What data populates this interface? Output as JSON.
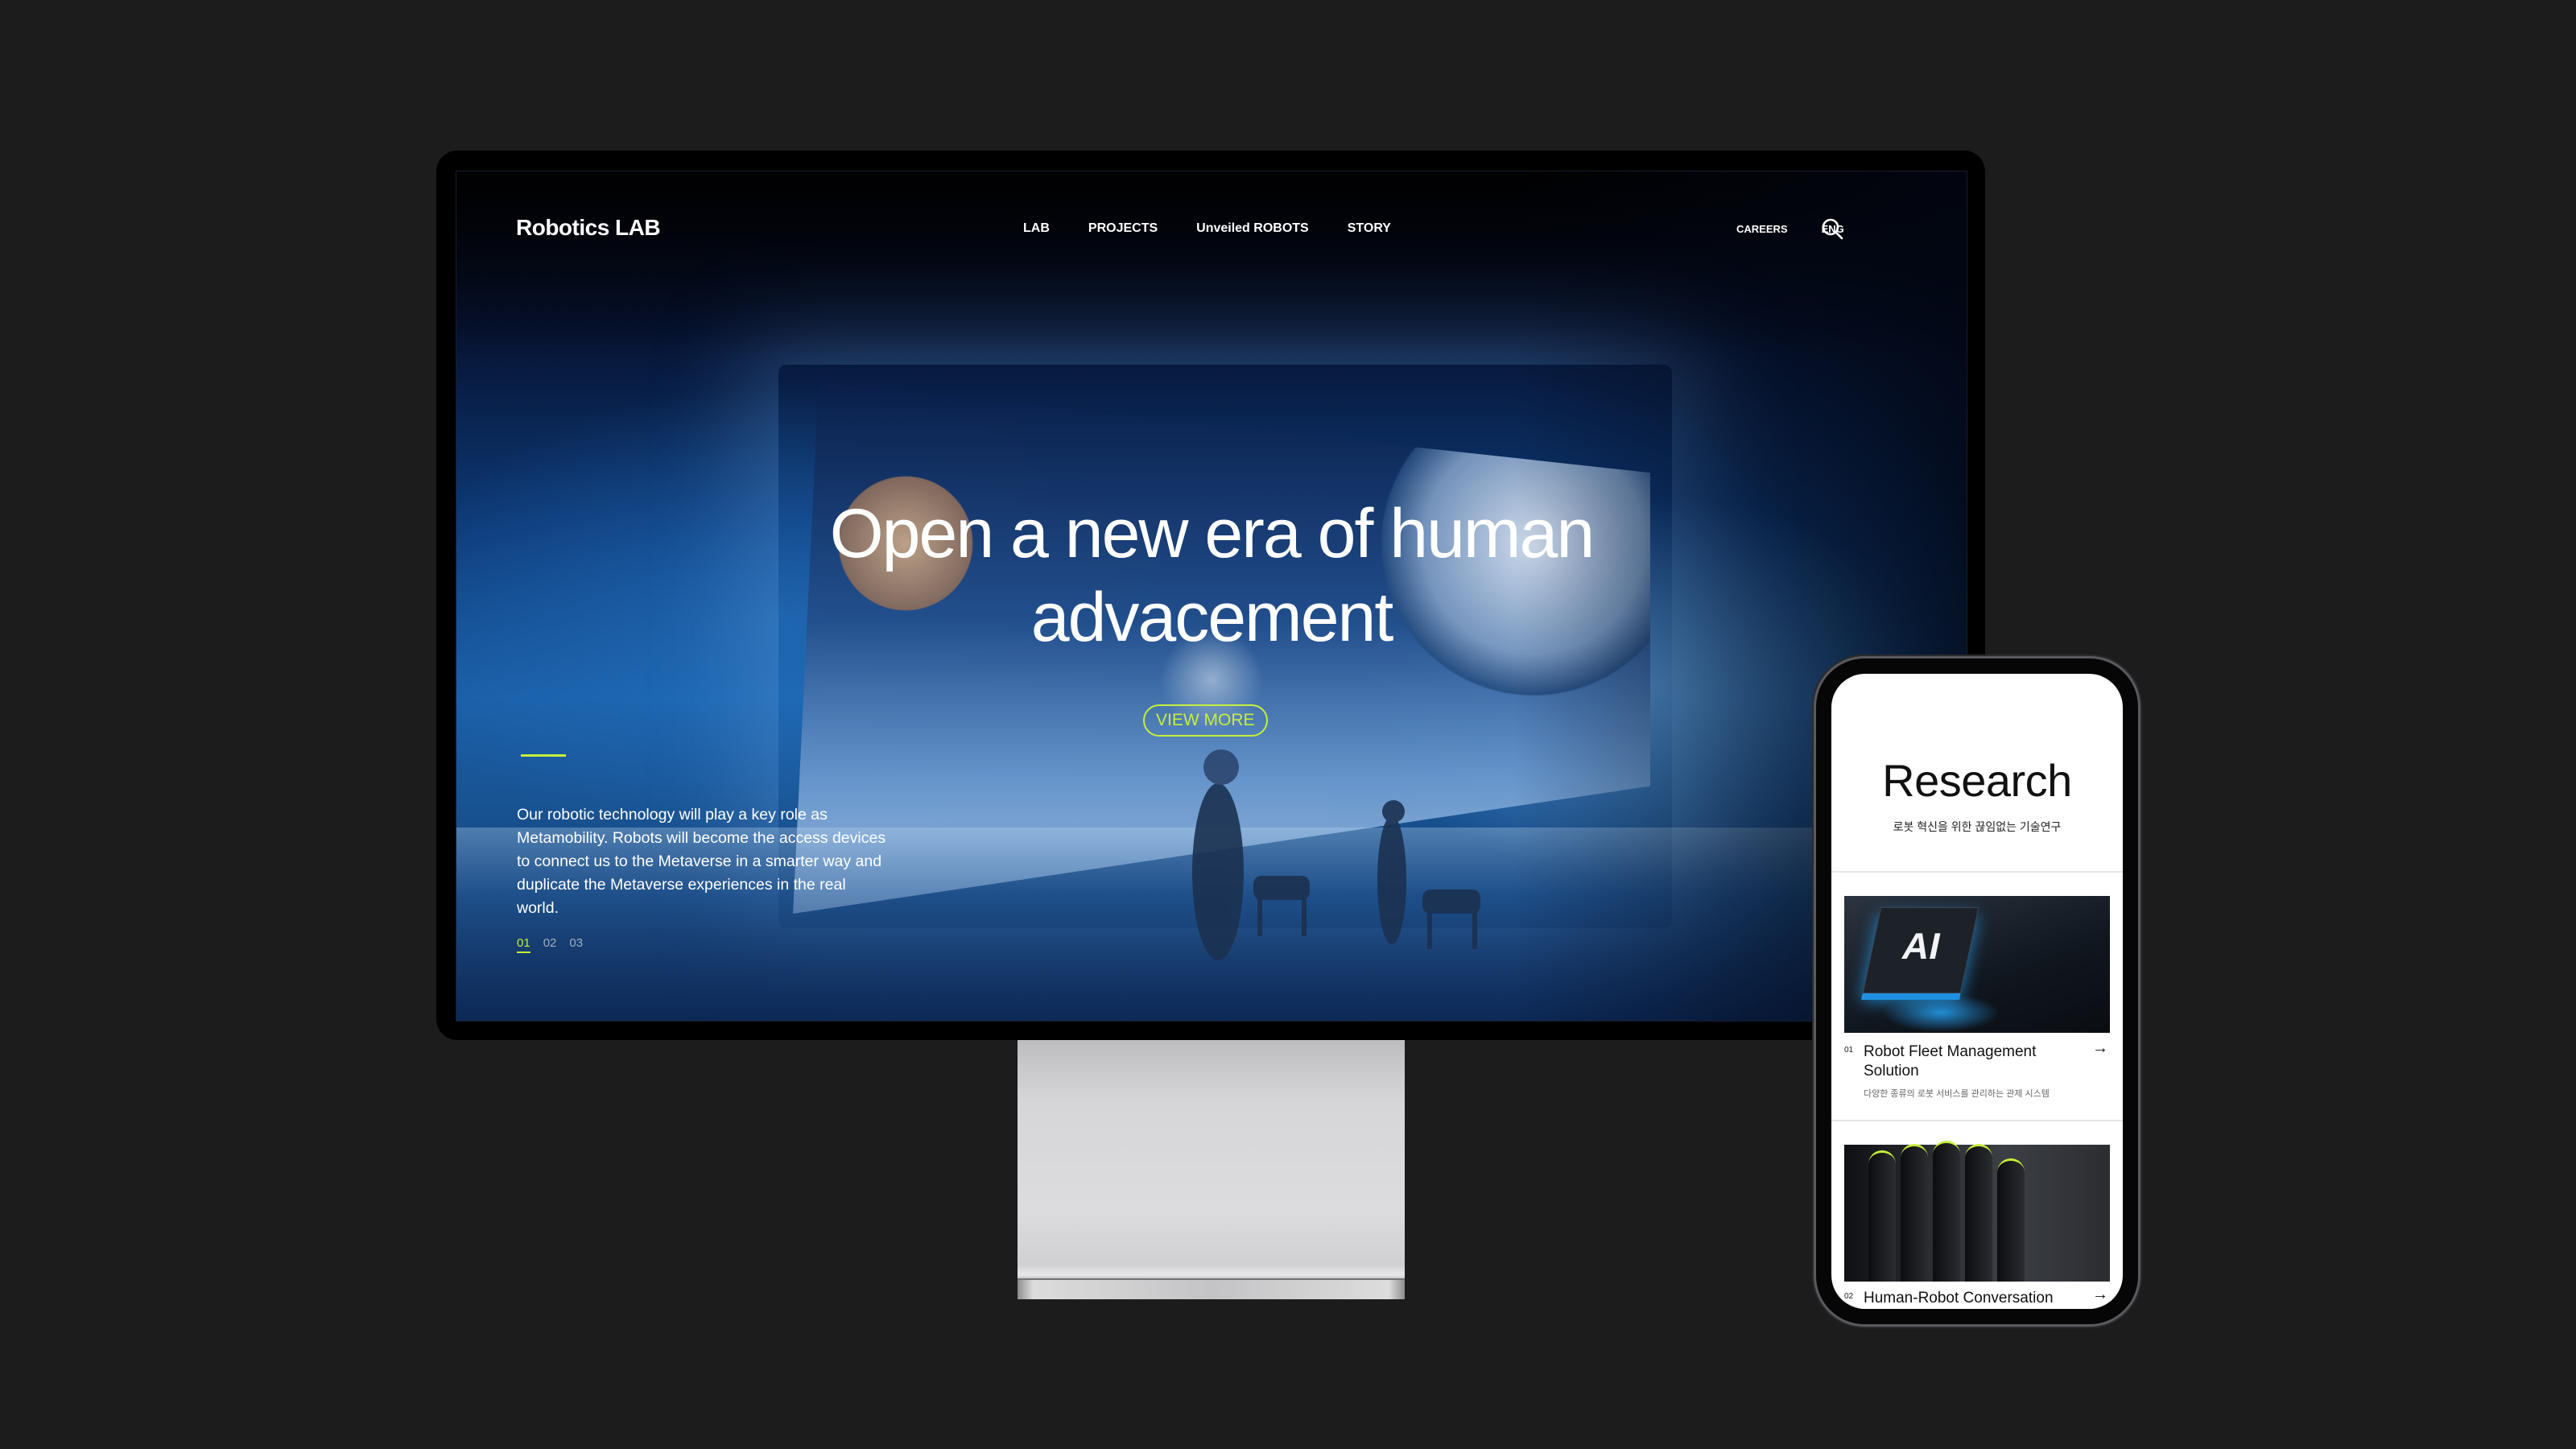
{
  "desktop": {
    "nav": {
      "logo": "Robotics LAB",
      "menu": [
        "LAB",
        "PROJECTS",
        "Unveiled ROBOTS",
        "STORY"
      ],
      "right": [
        "CAREERS",
        "ENG"
      ],
      "search_icon": "search-icon"
    },
    "hero": {
      "headline_line1": "Open a new era of human",
      "headline_line2": "advacement",
      "cta_label": "VIEW MORE",
      "description": "Our robotic technology will play a key role as Metamobility. Robots will become the access devices to connect us to the Metaverse in a smarter way and duplicate the Metaverse experiences in the real world.",
      "pager": [
        "01",
        "02",
        "03"
      ],
      "active_page": "01",
      "slide_progress": 0.45
    },
    "accent_color": "#c6ef3a"
  },
  "mobile": {
    "title": "Research",
    "subtitle": "로봇 혁신을 위한 끊임없는 기술연구",
    "cards": [
      {
        "num": "01",
        "title": "Robot Fleet Management Solution",
        "desc": "다양한 종류의 로봇 서비스를 관리하는 관제 시스템",
        "image_label": "AI",
        "arrow": "→"
      },
      {
        "num": "02",
        "title": "Human-Robot Conversation System",
        "desc": "",
        "arrow": "→"
      }
    ]
  }
}
